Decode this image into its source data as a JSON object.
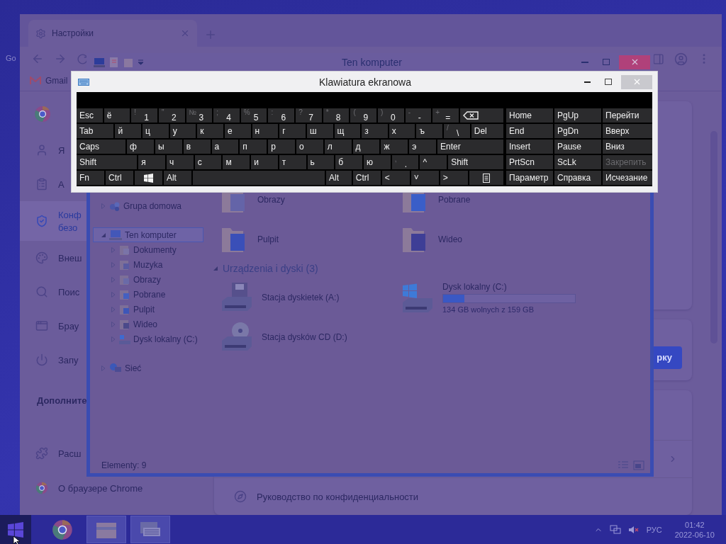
{
  "desktop": {
    "icon_label": "Go"
  },
  "browser": {
    "tab": {
      "title": "Настройки"
    },
    "bookmark": "Gmail",
    "menu": [
      {
        "kind": "person",
        "label": "Я",
        "selected": false
      },
      {
        "kind": "clipboard",
        "label": "А",
        "selected": false
      },
      {
        "kind": "shield",
        "label": "Конф",
        "label_2": "безо",
        "selected": true
      },
      {
        "kind": "palette",
        "label": "Внеш",
        "selected": false
      },
      {
        "kind": "search",
        "label": "Поис",
        "selected": false
      },
      {
        "kind": "browser",
        "label": "Брау",
        "selected": false
      },
      {
        "kind": "power",
        "label": "Запу",
        "selected": false
      }
    ],
    "section": "Дополните",
    "menu_2": [
      {
        "kind": "puzzle",
        "label": "Расш",
        "selected": false
      },
      {
        "kind": "chrome",
        "label": "О браузере Chrome",
        "selected": false
      }
    ],
    "button": "рку",
    "link": "Руководство по конфиденциальности"
  },
  "explorer": {
    "title": "Ten komputer",
    "nav": [
      {
        "kind": "homegroup",
        "label": "Grupa domowa",
        "expanded": false,
        "selected": false
      },
      {
        "kind": "computer",
        "label": "Ten komputer",
        "expanded": true,
        "selected": true,
        "children": [
          {
            "kind": "documents",
            "label": "Dokumenty",
            "expanded": false,
            "selected": false
          },
          {
            "kind": "music",
            "label": "Muzyka",
            "expanded": false,
            "selected": false
          },
          {
            "kind": "pictures",
            "label": "Obrazy",
            "expanded": false,
            "selected": false
          },
          {
            "kind": "downloads",
            "label": "Pobrane",
            "expanded": false,
            "selected": false
          },
          {
            "kind": "desktop",
            "label": "Pulpit",
            "expanded": false,
            "selected": false
          },
          {
            "kind": "video",
            "label": "Wideo",
            "expanded": false,
            "selected": false
          },
          {
            "kind": "drive",
            "label": "Dysk lokalny (C:)",
            "expanded": false,
            "selected": false
          }
        ]
      },
      {
        "kind": "network",
        "label": "Sieć",
        "expanded": false,
        "selected": false
      }
    ],
    "folders": [
      {
        "kind": "pictures",
        "name": "Obrazy"
      },
      {
        "kind": "downloads",
        "name": "Pobrane"
      },
      {
        "kind": "desktop",
        "name": "Pulpit"
      },
      {
        "kind": "video",
        "name": "Wideo"
      }
    ],
    "group": {
      "title": "Urządzenia i dyski (3)",
      "expanded": true
    },
    "drives": [
      {
        "kind": "floppy",
        "name": "Stacja dyskietek (A:)"
      },
      {
        "kind": "system",
        "name": "Dysk lokalny (C:)",
        "level": 0.16,
        "caption": "134 GB wolnych z 159 GB"
      },
      {
        "kind": "cd",
        "name": "Stacja dysków CD (D:)"
      }
    ],
    "status": "Elementy: 9"
  },
  "keyboard": {
    "title": "Klawiatura ekranowa",
    "rows": [
      [
        {
          "kind": "key",
          "label": "Esc"
        },
        {
          "kind": "key",
          "label": "ё"
        },
        {
          "kind": "dual",
          "shift": "!",
          "label": "1"
        },
        {
          "kind": "dual",
          "shift": "\"",
          "label": "2"
        },
        {
          "kind": "dual",
          "shift": "№",
          "label": "3"
        },
        {
          "kind": "dual",
          "shift": ";",
          "label": "4"
        },
        {
          "kind": "dual",
          "shift": "%",
          "label": "5"
        },
        {
          "kind": "dual",
          "shift": ":",
          "label": "6"
        },
        {
          "kind": "dual",
          "shift": "?",
          "label": "7"
        },
        {
          "kind": "dual",
          "shift": "*",
          "label": "8"
        },
        {
          "kind": "dual",
          "shift": "(",
          "label": "9"
        },
        {
          "kind": "dual",
          "shift": ")",
          "label": "0"
        },
        {
          "kind": "dual",
          "shift": "-",
          "label": "-"
        },
        {
          "kind": "dual",
          "shift": "+",
          "label": "="
        },
        {
          "kind": "backspace"
        }
      ],
      [
        {
          "kind": "key",
          "label": "Tab"
        },
        {
          "kind": "key",
          "label": "й"
        },
        {
          "kind": "key",
          "label": "ц"
        },
        {
          "kind": "key",
          "label": "у"
        },
        {
          "kind": "key",
          "label": "к"
        },
        {
          "kind": "key",
          "label": "е"
        },
        {
          "kind": "key",
          "label": "н"
        },
        {
          "kind": "key",
          "label": "г"
        },
        {
          "kind": "key",
          "label": "ш"
        },
        {
          "kind": "key",
          "label": "щ"
        },
        {
          "kind": "key",
          "label": "з"
        },
        {
          "kind": "key",
          "label": "х"
        },
        {
          "kind": "key",
          "label": "ъ"
        },
        {
          "kind": "dual",
          "shift": "/",
          "label": "\\"
        },
        {
          "kind": "key",
          "label": "Del"
        }
      ],
      [
        {
          "kind": "key",
          "label": "Caps"
        },
        {
          "kind": "key",
          "label": "ф"
        },
        {
          "kind": "key",
          "label": "ы"
        },
        {
          "kind": "key",
          "label": "в"
        },
        {
          "kind": "key",
          "label": "а"
        },
        {
          "kind": "key",
          "label": "п"
        },
        {
          "kind": "key",
          "label": "р"
        },
        {
          "kind": "key",
          "label": "о"
        },
        {
          "kind": "key",
          "label": "л"
        },
        {
          "kind": "key",
          "label": "д"
        },
        {
          "kind": "key",
          "label": "ж"
        },
        {
          "kind": "key",
          "label": "э"
        },
        {
          "kind": "key",
          "label": "Enter"
        }
      ],
      [
        {
          "kind": "key",
          "label": "Shift"
        },
        {
          "kind": "key",
          "label": "я"
        },
        {
          "kind": "key",
          "label": "ч"
        },
        {
          "kind": "key",
          "label": "с"
        },
        {
          "kind": "key",
          "label": "м"
        },
        {
          "kind": "key",
          "label": "и"
        },
        {
          "kind": "key",
          "label": "т"
        },
        {
          "kind": "key",
          "label": "ь"
        },
        {
          "kind": "key",
          "label": "б"
        },
        {
          "kind": "key",
          "label": "ю"
        },
        {
          "kind": "dual",
          "shift": ",",
          "label": "."
        },
        {
          "kind": "key",
          "label": "^"
        },
        {
          "kind": "key",
          "label": "Shift"
        }
      ],
      [
        {
          "kind": "key",
          "label": "Fn"
        },
        {
          "kind": "key",
          "label": "Ctrl"
        },
        {
          "kind": "windows"
        },
        {
          "kind": "key",
          "label": "Alt"
        },
        {
          "kind": "space"
        },
        {
          "kind": "key",
          "label": "Alt"
        },
        {
          "kind": "key",
          "label": "Ctrl"
        },
        {
          "kind": "key",
          "label": "<"
        },
        {
          "kind": "key",
          "label": "˅"
        },
        {
          "kind": "key",
          "label": ">"
        },
        {
          "kind": "menu"
        }
      ]
    ],
    "side_rows": [
      [
        {
          "label": "Home",
          "disabled": false
        },
        {
          "label": "PgUp",
          "disabled": false
        },
        {
          "label": "Перейти",
          "disabled": false
        }
      ],
      [
        {
          "label": "End",
          "disabled": false
        },
        {
          "label": "PgDn",
          "disabled": false
        },
        {
          "label": "Вверх",
          "disabled": false
        }
      ],
      [
        {
          "label": "Insert",
          "disabled": false
        },
        {
          "label": "Pause",
          "disabled": false
        },
        {
          "label": "Вниз",
          "disabled": false
        }
      ],
      [
        {
          "label": "PrtScn",
          "disabled": false
        },
        {
          "label": "ScLk",
          "disabled": false
        },
        {
          "label": "Закрепить",
          "disabled": true
        }
      ],
      [
        {
          "label": "Параметр",
          "disabled": false
        },
        {
          "label": "Справка",
          "disabled": false
        },
        {
          "label": "Исчезание",
          "disabled": false
        }
      ]
    ]
  },
  "taskbar": {
    "apps": [
      {
        "kind": "chrome",
        "highlighted": false
      },
      {
        "kind": "explorer",
        "highlighted": true
      },
      {
        "kind": "keyboard",
        "highlighted": true
      }
    ],
    "language": "РУС",
    "time": "01:42",
    "date": "2022-06-10"
  }
}
